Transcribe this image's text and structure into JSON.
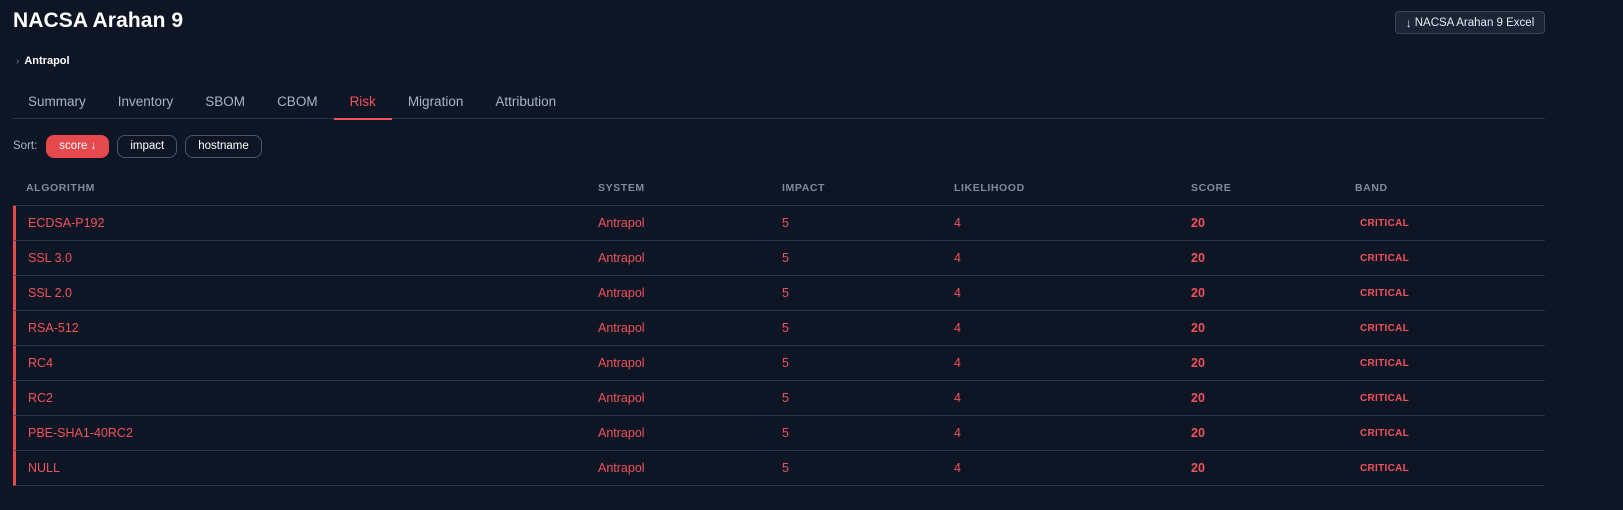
{
  "page": {
    "title": "NACSA Arahan 9"
  },
  "export": {
    "icon": "↓",
    "label": "NACSA Arahan 9 Excel"
  },
  "breadcrumb": {
    "chevron": "›",
    "label": "Antrapol"
  },
  "tabs": [
    {
      "label": "Summary"
    },
    {
      "label": "Inventory"
    },
    {
      "label": "SBOM"
    },
    {
      "label": "CBOM"
    },
    {
      "label": "Risk",
      "active": true
    },
    {
      "label": "Migration"
    },
    {
      "label": "Attribution"
    }
  ],
  "sort": {
    "label": "Sort:",
    "options": [
      {
        "label": "score ↓",
        "active": true
      },
      {
        "label": "impact"
      },
      {
        "label": "hostname"
      }
    ]
  },
  "table": {
    "columns": [
      "ALGORITHM",
      "SYSTEM",
      "IMPACT",
      "LIKELIHOOD",
      "SCORE",
      "BAND"
    ],
    "rows": [
      [
        "ECDSA-P192",
        "Antrapol",
        "5",
        "4",
        "20",
        "CRITICAL"
      ],
      [
        "SSL 3.0",
        "Antrapol",
        "5",
        "4",
        "20",
        "CRITICAL"
      ],
      [
        "SSL 2.0",
        "Antrapol",
        "5",
        "4",
        "20",
        "CRITICAL"
      ],
      [
        "RSA-512",
        "Antrapol",
        "5",
        "4",
        "20",
        "CRITICAL"
      ],
      [
        "RC4",
        "Antrapol",
        "5",
        "4",
        "20",
        "CRITICAL"
      ],
      [
        "RC2",
        "Antrapol",
        "5",
        "4",
        "20",
        "CRITICAL"
      ],
      [
        "PBE-SHA1-40RC2",
        "Antrapol",
        "5",
        "4",
        "20",
        "CRITICAL"
      ],
      [
        "NULL",
        "Antrapol",
        "5",
        "4",
        "20",
        "CRITICAL"
      ]
    ]
  },
  "colors": {
    "background": "#0e1626",
    "accent": "#e5484d",
    "critical_text": "#f0535a",
    "muted": "#7e8aa0"
  }
}
